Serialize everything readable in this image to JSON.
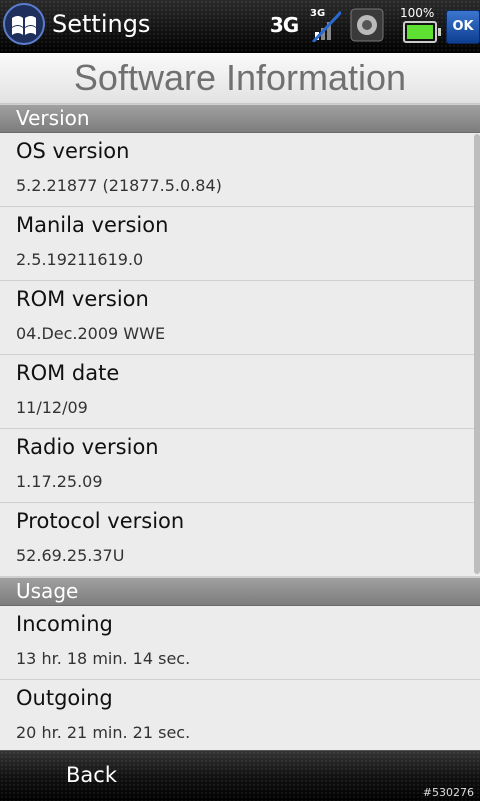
{
  "status_bar": {
    "app_title": "Settings",
    "network_type": "3G",
    "signal_network_label": "3G",
    "battery_percent": "100%",
    "battery_level": 0.86,
    "ok_label": "OK",
    "icons": [
      "windows-logo-icon",
      "signal-icon",
      "sync-icon",
      "battery-icon"
    ]
  },
  "page": {
    "title": "Software Information"
  },
  "sections": {
    "version": {
      "header": "Version",
      "items": [
        {
          "label": "OS version",
          "value": "5.2.21877 (21877.5.0.84)"
        },
        {
          "label": "Manila version",
          "value": "2.5.19211619.0"
        },
        {
          "label": "ROM version",
          "value": "04.Dec.2009 WWE"
        },
        {
          "label": "ROM date",
          "value": "11/12/09"
        },
        {
          "label": "Radio version",
          "value": "1.17.25.09"
        },
        {
          "label": "Protocol version",
          "value": "52.69.25.37U"
        }
      ]
    },
    "usage": {
      "header": "Usage",
      "items": [
        {
          "label": "Incoming",
          "value": "13 hr. 18 min. 14 sec."
        },
        {
          "label": "Outgoing",
          "value": "20 hr. 21 min. 21 sec."
        }
      ]
    }
  },
  "bottom_bar": {
    "back_label": "Back",
    "watermark": "#530276"
  }
}
